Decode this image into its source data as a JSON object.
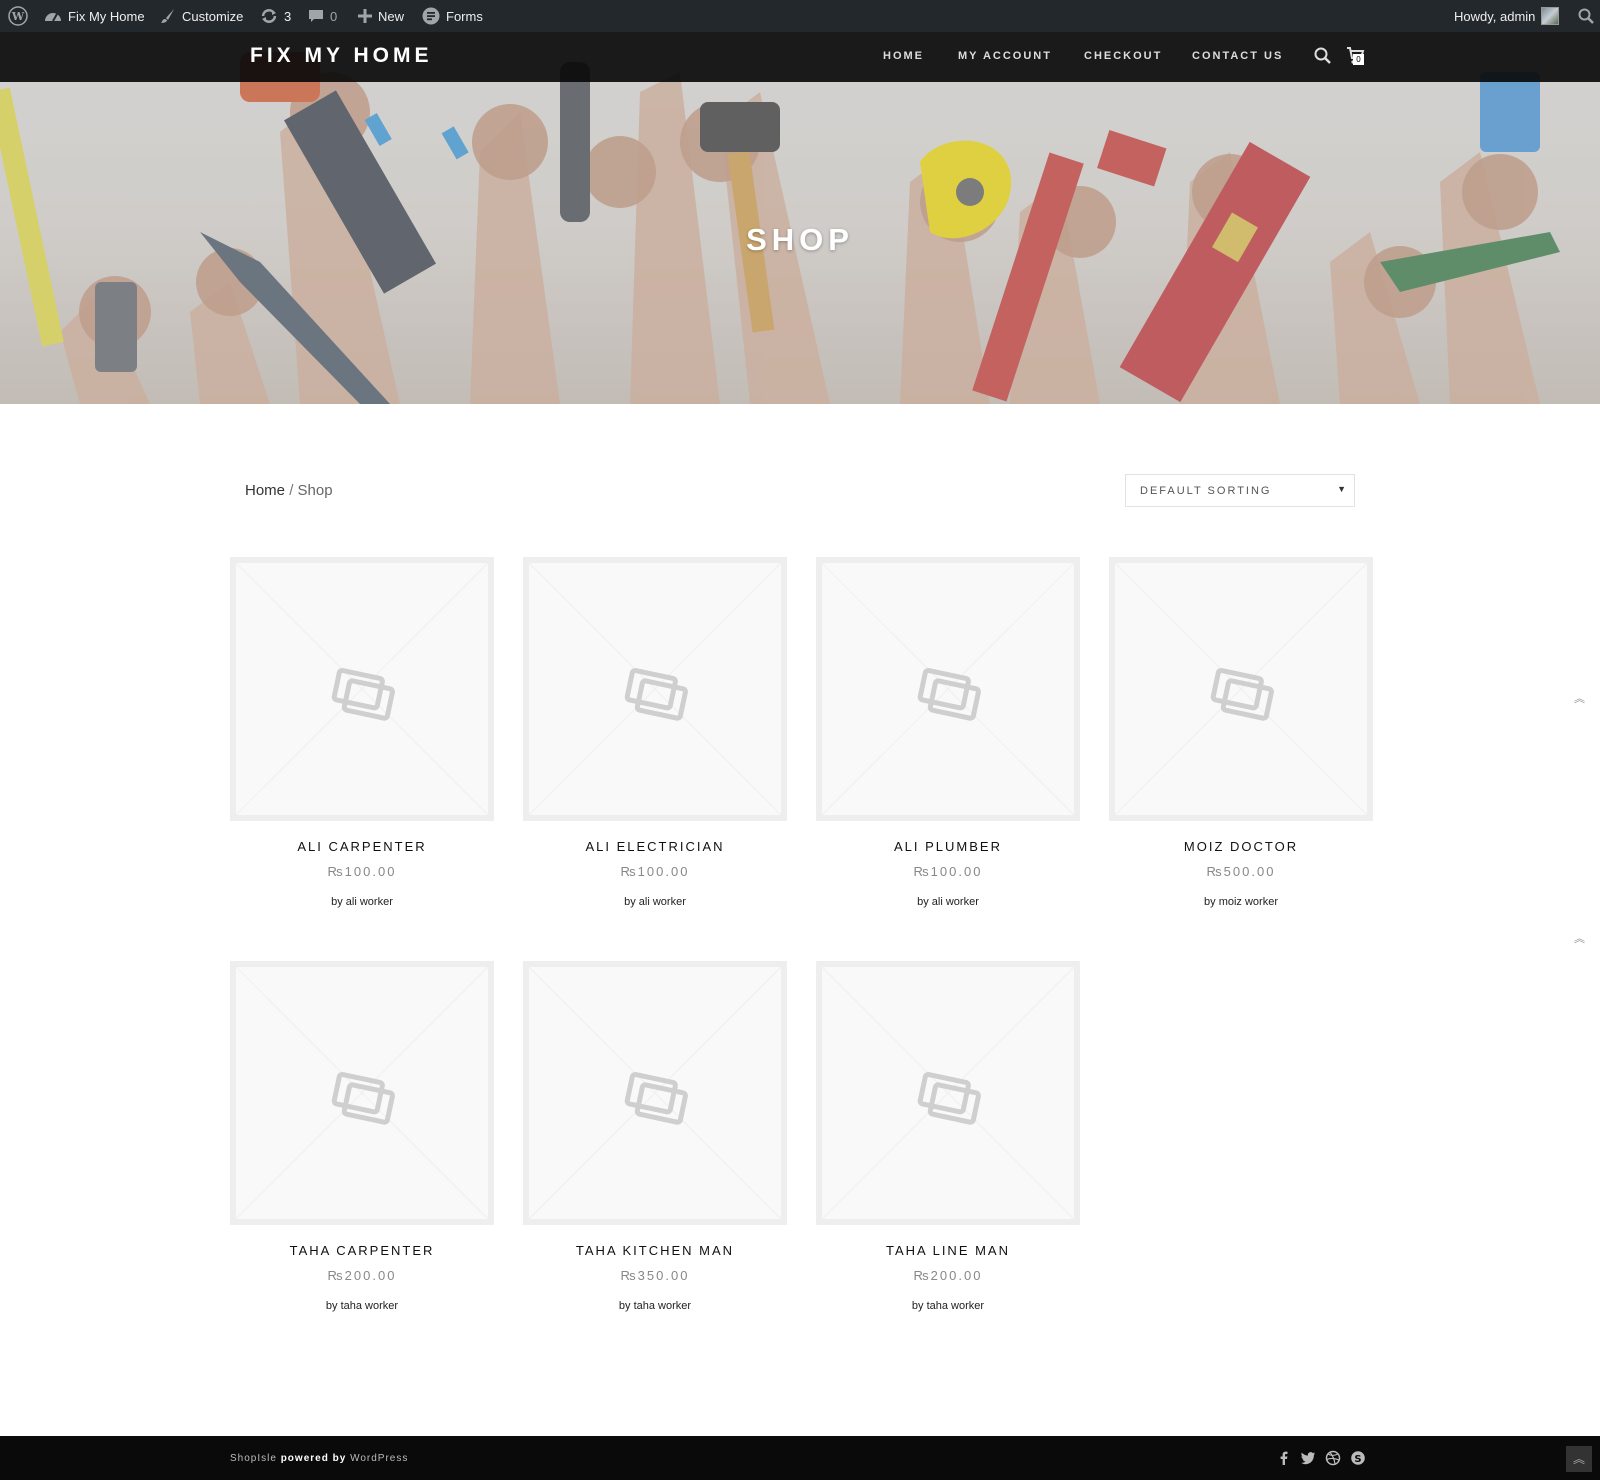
{
  "admin_bar": {
    "site_name": "Fix My Home",
    "customize": "Customize",
    "updates_count": "3",
    "comments_count": "0",
    "new_label": "New",
    "forms_label": "Forms",
    "howdy": "Howdy, admin"
  },
  "header": {
    "site_title": "FIX MY HOME",
    "nav": [
      "HOME",
      "MY ACCOUNT",
      "CHECKOUT",
      "CONTACT US"
    ],
    "cart_count": "0"
  },
  "hero": {
    "title": "SHOP"
  },
  "breadcrumb": {
    "home": "Home",
    "separator": "/",
    "current": "Shop"
  },
  "sorting": {
    "selected": "DEFAULT SORTING"
  },
  "products": [
    {
      "title": "ALI CARPENTER",
      "price": "₨100.00",
      "vendor": "by ali worker"
    },
    {
      "title": "ALI ELECTRICIAN",
      "price": "₨100.00",
      "vendor": "by ali worker"
    },
    {
      "title": "ALI PLUMBER",
      "price": "₨100.00",
      "vendor": "by ali worker"
    },
    {
      "title": "MOIZ DOCTOR",
      "price": "₨500.00",
      "vendor": "by moiz worker"
    },
    {
      "title": "TAHA CARPENTER",
      "price": "₨200.00",
      "vendor": "by taha worker"
    },
    {
      "title": "TAHA KITCHEN MAN",
      "price": "₨350.00",
      "vendor": "by taha worker"
    },
    {
      "title": "TAHA LINE MAN",
      "price": "₨200.00",
      "vendor": "by taha worker"
    }
  ],
  "footer": {
    "theme": "ShopIsle",
    "powered_by": "powered by",
    "platform": "WordPress",
    "social_icons": [
      "facebook-icon",
      "twitter-icon",
      "dribbble-icon",
      "skype-icon"
    ]
  },
  "colors": {
    "admin_bar_bg": "#23282d",
    "header_bg": "#0a0a0a",
    "footer_bg": "#0a0a0a",
    "placeholder_border": "#eeeeee"
  }
}
